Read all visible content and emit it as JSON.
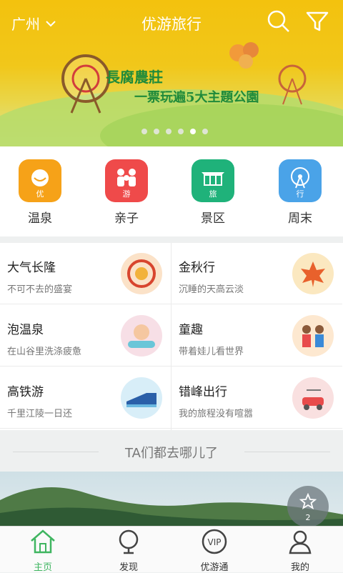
{
  "header": {
    "city": "广州",
    "title": "优游旅行",
    "banner_line1": "長腐農莊",
    "banner_line2": "一票玩遍5大主題公園",
    "banner_dots": 6,
    "banner_active_dot": 4
  },
  "categories": [
    {
      "label": "温泉",
      "tag": "优",
      "color": "#f6a218"
    },
    {
      "label": "亲子",
      "tag": "游",
      "color": "#ef4a4a"
    },
    {
      "label": "景区",
      "tag": "旅",
      "color": "#1fb27a"
    },
    {
      "label": "周末",
      "tag": "行",
      "color": "#4aa3e8"
    }
  ],
  "themes": [
    {
      "title": "大气长隆",
      "subtitle": "不可不去的盛宴"
    },
    {
      "title": "金秋行",
      "subtitle": "沉睡的天高云淡"
    },
    {
      "title": "泡温泉",
      "subtitle": "在山谷里洗涤疲惫"
    },
    {
      "title": "童趣",
      "subtitle": "带着娃儿看世界"
    },
    {
      "title": "高铁游",
      "subtitle": "千里江陵一日还"
    },
    {
      "title": "错峰出行",
      "subtitle": "我的旅程没有喧嚣"
    }
  ],
  "section_title": "TA们都去哪儿了",
  "favorite": {
    "count": "2"
  },
  "nav": [
    {
      "label": "主页",
      "icon": "home-icon",
      "active": true
    },
    {
      "label": "发现",
      "icon": "discover-icon",
      "active": false
    },
    {
      "label": "优游通",
      "icon": "vip-icon",
      "active": false
    },
    {
      "label": "我的",
      "icon": "profile-icon",
      "active": false
    }
  ],
  "colors": {
    "accent": "#3fb560",
    "banner": "#f3c20e"
  }
}
